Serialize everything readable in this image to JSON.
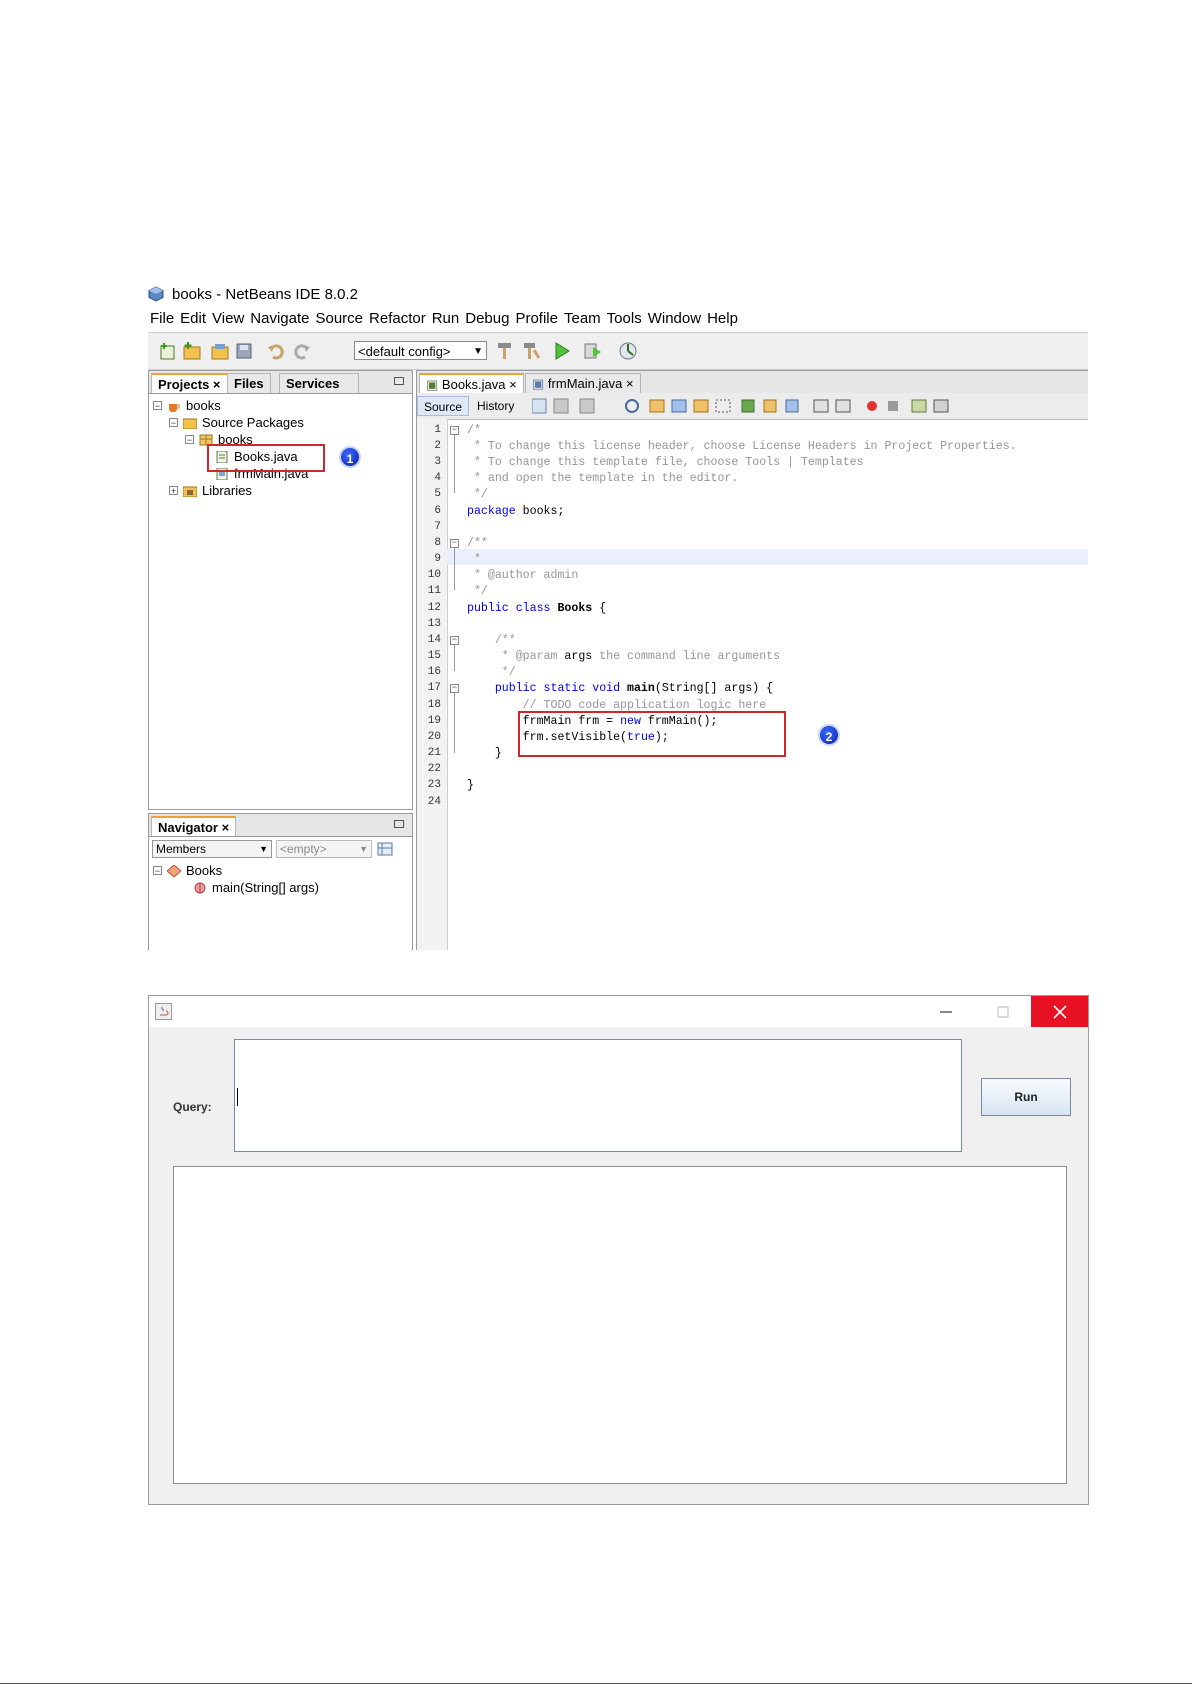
{
  "ide": {
    "window_title": "books - NetBeans IDE 8.0.2",
    "menu": [
      "File",
      "Edit",
      "View",
      "Navigate",
      "Source",
      "Refactor",
      "Run",
      "Debug",
      "Profile",
      "Team",
      "Tools",
      "Window",
      "Help"
    ],
    "config_select": "<default config>",
    "project_tabs": {
      "projects": "Projects",
      "files": "Files",
      "services": "Services"
    },
    "tree": {
      "project": "books",
      "source_packages": "Source Packages",
      "package": "books",
      "file1": "Books.java",
      "file2": "frmMain.java",
      "libraries": "Libraries"
    },
    "navigator": {
      "title": "Navigator",
      "members": "Members",
      "empty": "<empty>",
      "class": "Books",
      "method": "main(String[] args)"
    },
    "editor_tabs": [
      "Books.java",
      "frmMain.java"
    ],
    "editor_modes": {
      "source": "Source",
      "history": "History"
    },
    "badges": [
      "1",
      "2"
    ],
    "code": {
      "l1": "/*",
      "l2": " * To change this license header, choose License Headers in Project Properties.",
      "l3": " * To change this template file, choose Tools | Templates",
      "l4": " * and open the template in the editor.",
      "l5": " */",
      "l6_kw": "package",
      "l6_rest": " books;",
      "l8": "/**",
      "l9": " *",
      "l10": " * @author admin",
      "l11": " */",
      "l12_kw": "public class",
      "l12_name": " Books",
      "l12_rest": " {",
      "l14": "    /**",
      "l15_a": "     * @param ",
      "l15_b": "args",
      "l15_c": " the command line arguments",
      "l16": "     */",
      "l17_kw": "    public static void",
      "l17_name": " main",
      "l17_rest": "(String[] args) {",
      "l18": "        // TODO code application logic here",
      "l19_a": "        frmMain frm = ",
      "l19_kw": "new",
      "l19_b": " frmMain();",
      "l20_a": "        frm.setVisible(",
      "l20_kw": "true",
      "l20_b": ");",
      "l21": "    }",
      "l23": "}"
    }
  },
  "frame": {
    "query_label": "Query:",
    "run_button": "Run"
  }
}
